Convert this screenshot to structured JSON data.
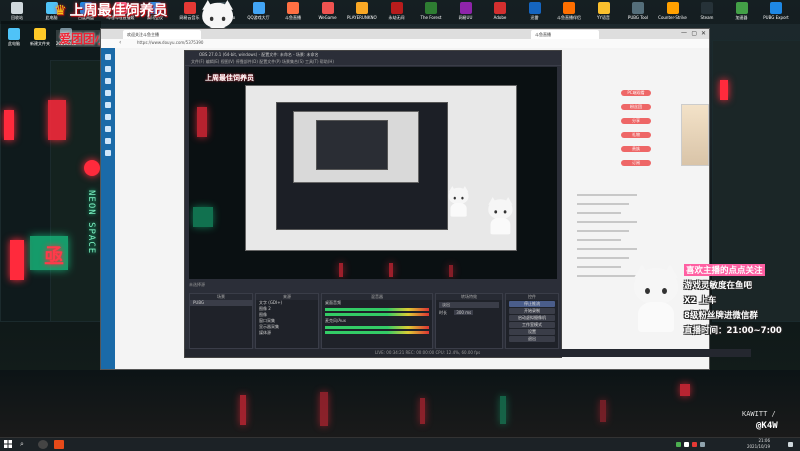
{
  "stream_overlay": {
    "title": "上周最佳饲养员",
    "subtitle": "爱团团小可"
  },
  "desktop_top_icons": [
    {
      "label": "回收站",
      "color": "#cfd8dc"
    },
    {
      "label": "此电脑",
      "color": "#4fc3f7"
    },
    {
      "label": "百度网盘",
      "color": "#1e88e5"
    },
    {
      "label": "哔哩哔哩直播姬",
      "color": "#fb7299"
    },
    {
      "label": "腾讯会议",
      "color": "#2196f3"
    },
    {
      "label": "网易云音乐",
      "color": "#e53935"
    },
    {
      "label": "OBS Studio",
      "color": "#37474f"
    },
    {
      "label": "QQ游戏大厅",
      "color": "#42a5f5"
    },
    {
      "label": "斗鱼直播",
      "color": "#ff7043"
    },
    {
      "label": "WeGame",
      "color": "#ef5350"
    },
    {
      "label": "PLAYERUNKNOWN",
      "color": "#f9a825"
    },
    {
      "label": "永劫无间",
      "color": "#b71c1c"
    },
    {
      "label": "The Forest",
      "color": "#2e7d32"
    },
    {
      "label": "网易UU",
      "color": "#8e24aa"
    },
    {
      "label": "Adobe",
      "color": "#d32f2f"
    },
    {
      "label": "迅雷",
      "color": "#1565c0"
    },
    {
      "label": "斗鱼直播伴侣",
      "color": "#ff6f00"
    },
    {
      "label": "YY语音",
      "color": "#fbc02d"
    },
    {
      "label": "PUBG Tool",
      "color": "#546e7a"
    },
    {
      "label": "Counter-Strike",
      "color": "#ffa000"
    },
    {
      "label": "Steam",
      "color": "#263238"
    },
    {
      "label": "加速器",
      "color": "#43a047"
    },
    {
      "label": "PUBG Export",
      "color": "#1e88e5"
    }
  ],
  "desktop_left_icons": [
    {
      "label": "此电脑",
      "color": "#4fc3f7"
    },
    {
      "label": "新建文件夹",
      "color": "#ffca28"
    },
    {
      "label": "20210311",
      "color": "#78909c"
    }
  ],
  "browser": {
    "tab_label": "欢迎关注斗鱼主播",
    "tab2_label": "斗鱼直播",
    "url": "https://www.douyu.com/5375390",
    "right_tags": [
      "PC端观看",
      "粉丝团",
      "分享",
      "礼物",
      "贵族",
      "订阅"
    ]
  },
  "obs": {
    "window_title": "OBS 27.0.1 (64-bit, windows) - 配置文件: 未命名 - 场景: 未命名",
    "menu": "文件(F)  编辑(E)  视图(V)  停靠部件(D)  配置文件(P)  场景集合(S)  工具(T)  帮助(H)",
    "no_source_selected": "未选择源",
    "docks": {
      "scenes_header": "场景",
      "sources_header": "来源",
      "mixer_header": "混音器",
      "transitions_header": "转场特效",
      "controls_header": "控件"
    },
    "scenes": [
      "PUBG"
    ],
    "sources": [
      "文字 (GDI+)",
      "图像 2",
      "图像",
      "窗口采集",
      "显示器采集",
      "媒体源"
    ],
    "mixer_channels": [
      {
        "name": "桌面音频",
        "level": "0.0 dB"
      },
      {
        "name": "麦克风/Aux",
        "level": "0.0 dB"
      }
    ],
    "transition": {
      "type": "淡出",
      "duration_label": "时长",
      "duration": "300 ms"
    },
    "controls": [
      "停止推流",
      "开始录制",
      "启动虚拟摄像机",
      "工作室模式",
      "设置",
      "退出"
    ],
    "status": "LIVE: 00:34:21   REC: 00:00:00   CPU: 12.4%, 60.00 fps"
  },
  "overlay_info": {
    "line1": "喜欢主播的点点关注",
    "line2": "游戏灵敏度在鱼吧",
    "line3": "X2 上车",
    "line4": "8级粉丝牌进微信群",
    "line5": "直播时间：21:00~7:00"
  },
  "watermark": {
    "line1": "KAWITT /",
    "line2": "@K4W"
  },
  "taskbar": {
    "time": "21:06",
    "date": "2021/10/19"
  }
}
